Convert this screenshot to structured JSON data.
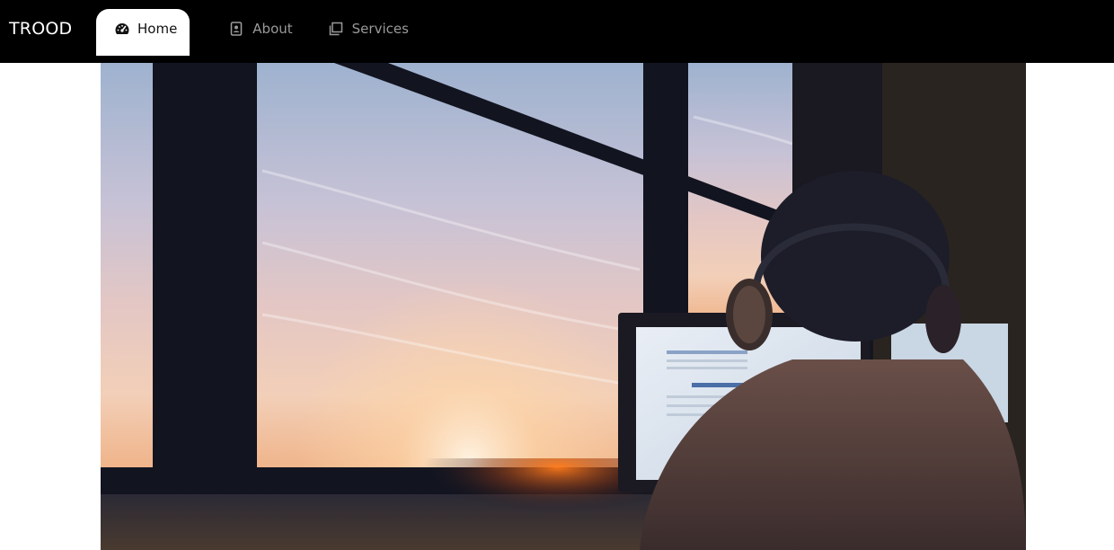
{
  "navbar": {
    "brand": "TROOD",
    "tabs": [
      {
        "label": "Home",
        "icon": "dashboard-icon",
        "active": true
      },
      {
        "label": "About",
        "icon": "contact-card-icon",
        "active": false
      },
      {
        "label": "Services",
        "icon": "stacked-windows-icon",
        "active": false
      }
    ]
  },
  "colors": {
    "navbar_bg": "#000000",
    "active_tab_bg": "#ffffff",
    "inactive_tab_text": "#9a9a9a",
    "active_tab_text": "#111111"
  },
  "hero": {
    "image": "photo-person-with-headphones-at-computer-by-window-at-sunset"
  }
}
